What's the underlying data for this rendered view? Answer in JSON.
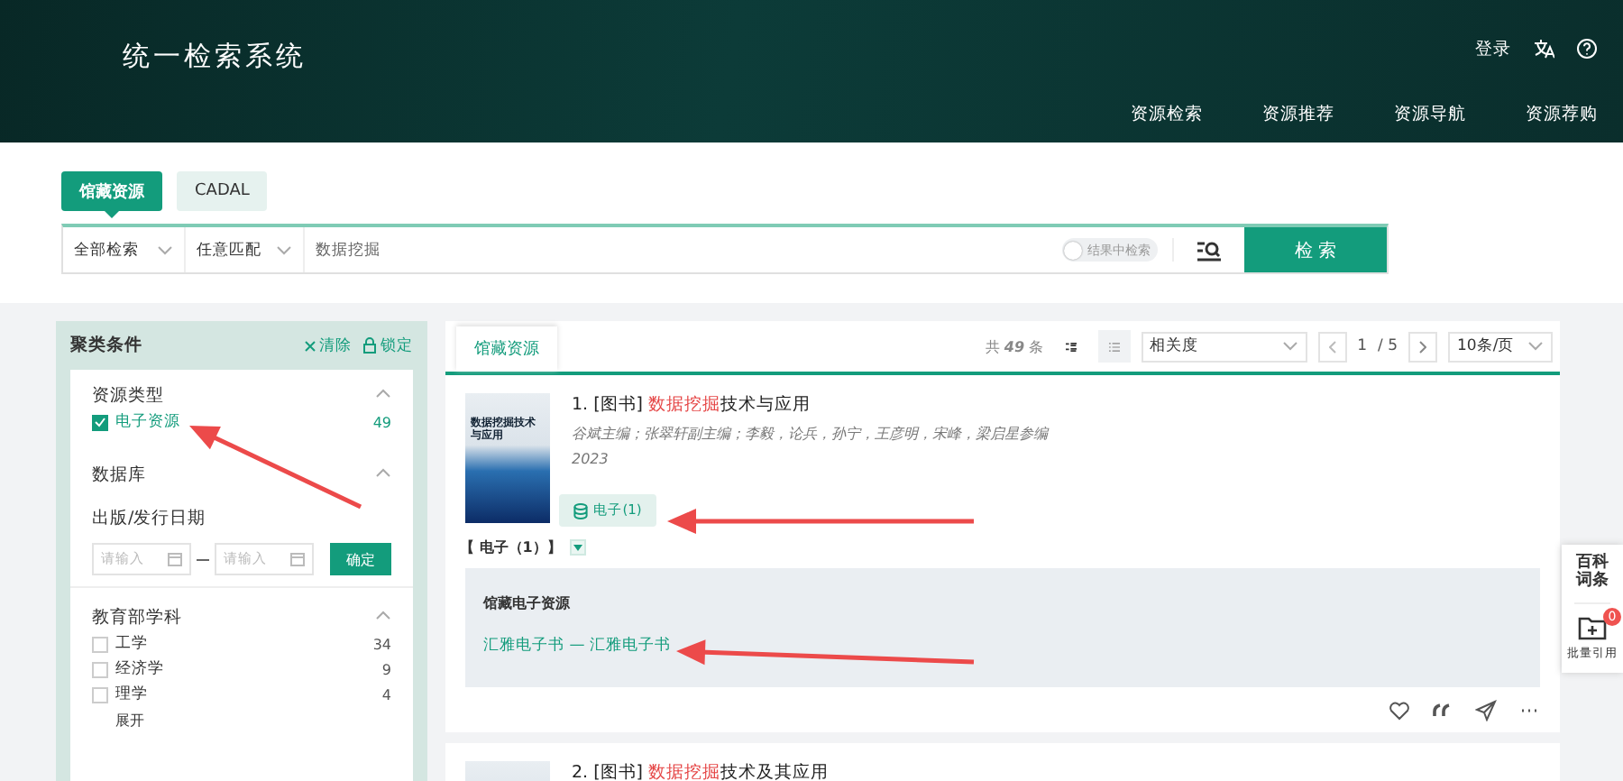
{
  "header": {
    "title": "统一检索系统",
    "login": "登录",
    "nav": [
      {
        "label": "资源检索"
      },
      {
        "label": "资源推荐"
      },
      {
        "label": "资源导航"
      },
      {
        "label": "资源荐购"
      }
    ]
  },
  "search": {
    "tabs": [
      {
        "label": "馆藏资源",
        "selected": true
      },
      {
        "label": "CADAL",
        "selected": false
      }
    ],
    "scope": "全部检索",
    "match": "任意匹配",
    "value": "数据挖掘",
    "within_results": {
      "label": "结果中检索",
      "on": false
    },
    "button": "检 索"
  },
  "filters": {
    "title": "聚类条件",
    "clear": "清除",
    "lock": "锁定",
    "groups": [
      {
        "kind": "list",
        "title": "资源类型",
        "expanded": true,
        "items": [
          {
            "label": "电子资源",
            "count": "49",
            "checked": true
          }
        ]
      },
      {
        "kind": "list",
        "title": "数据库",
        "expanded": true
      },
      {
        "kind": "date",
        "title": "出版/发行日期",
        "from_placeholder": "请输入",
        "to_placeholder": "请输入",
        "confirm": "确定"
      },
      {
        "kind": "list",
        "title": "教育部学科",
        "expanded": true,
        "items": [
          {
            "label": "工学",
            "count": "34",
            "checked": false
          },
          {
            "label": "经济学",
            "count": "9",
            "checked": false
          },
          {
            "label": "理学",
            "count": "4",
            "checked": false
          }
        ],
        "more": "展开"
      }
    ]
  },
  "results": {
    "tab": "馆藏资源",
    "total_prefix": "共",
    "total": "49",
    "total_suffix": "条",
    "views": [
      {
        "kind": "card",
        "selected": true
      },
      {
        "kind": "list",
        "selected": false
      }
    ],
    "sort": "相关度",
    "page": "1",
    "pages": "/ 5",
    "page_size": "10条/页",
    "items": [
      {
        "prefix": "1. [图书] ",
        "highlight": "数据挖掘",
        "rest": "技术与应用",
        "authors": "谷斌主编；张翠轩副主编；李毅，论兵，孙宁，王彦明，宋峰，梁启星参编",
        "year": "2023",
        "badge": "电子(1)",
        "cover_title": "数据挖掘技术与应用",
        "holdings": {
          "heading": "【 电子（1）】",
          "expanded": true,
          "source": "馆藏电子资源",
          "link": "汇雅电子书 — 汇雅电子书"
        }
      },
      {
        "prefix": "2. [图书] ",
        "highlight": "数据挖掘",
        "rest": "技术及其应用"
      }
    ]
  },
  "side_tools": [
    {
      "kind": "text",
      "label": "百科词条"
    },
    {
      "kind": "cite",
      "label": "批量引用",
      "count": "0"
    }
  ]
}
